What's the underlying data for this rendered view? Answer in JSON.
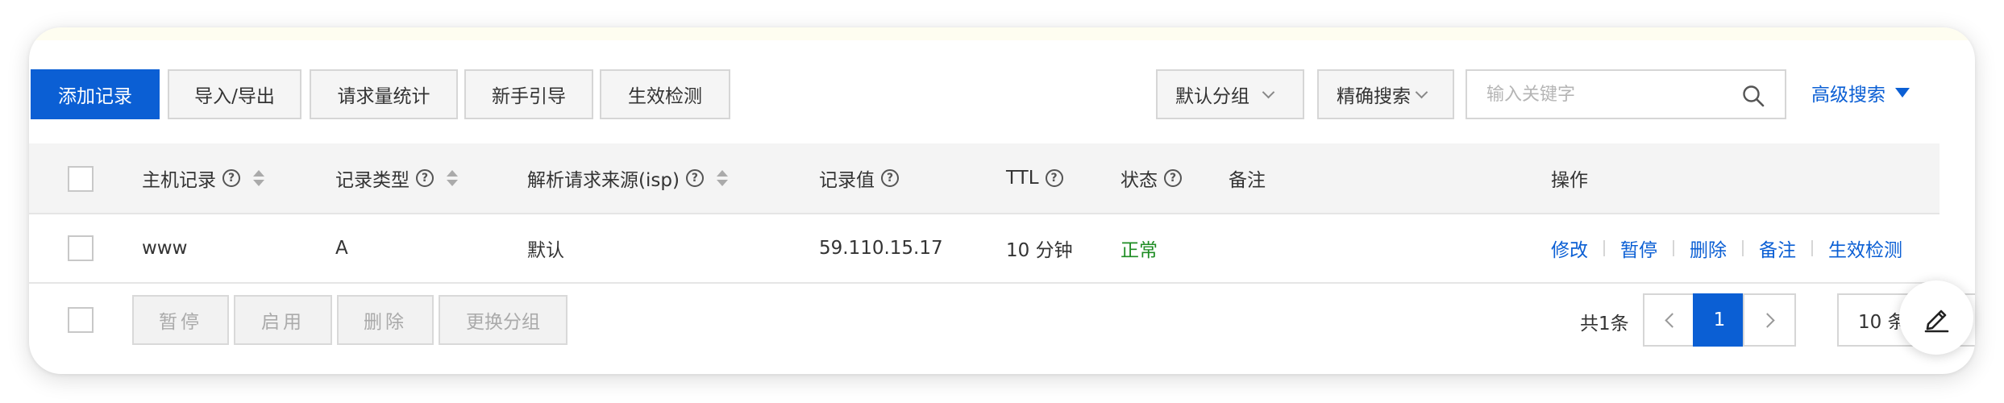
{
  "toolbar": {
    "add_record": "添加记录",
    "import_export": "导入/导出",
    "request_stats": "请求量统计",
    "beginner_guide": "新手引导",
    "effect_check": "生效检测",
    "group_select": "默认分组",
    "search_mode": "精确搜索",
    "search_placeholder": "输入关键字",
    "search_value": "",
    "advanced_search": "高级搜索"
  },
  "table": {
    "headers": {
      "host": "主机记录",
      "type": "记录类型",
      "source": "解析请求来源(isp)",
      "value": "记录值",
      "ttl": "TTL",
      "status": "状态",
      "remark": "备注",
      "ops": "操作"
    },
    "rows": [
      {
        "host": "www",
        "type": "A",
        "source": "默认",
        "value": "59.110.15.17",
        "ttl": "10 分钟",
        "status": "正常",
        "remark": "",
        "ops": [
          "修改",
          "暂停",
          "删除",
          "备注",
          "生效检测"
        ]
      }
    ]
  },
  "footer": {
    "pause": "暂停",
    "enable": "启用",
    "delete": "删除",
    "change_group": "更换分组",
    "total": "共1条",
    "current_page": "1",
    "page_size": "10 条/页"
  },
  "colors": {
    "primary": "#0b5fd4",
    "status_ok": "#1e8c23"
  },
  "icons": [
    "search-icon",
    "help-icon",
    "sort-icon",
    "chevron-down-icon",
    "caret-down-icon",
    "chevron-left-icon",
    "chevron-right-icon",
    "edit-icon"
  ]
}
